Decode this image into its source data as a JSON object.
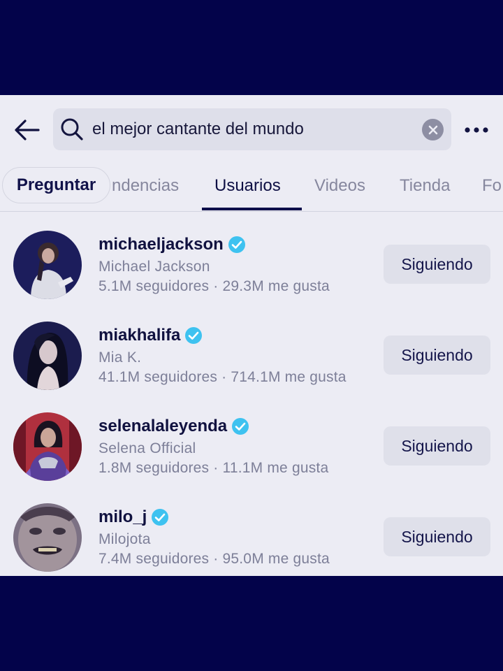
{
  "search": {
    "query": "el mejor cantante del mundo"
  },
  "tabs": {
    "pill_label": "Preguntar",
    "items": [
      {
        "label": "ndencias"
      },
      {
        "label": "Usuarios"
      },
      {
        "label": "Videos"
      },
      {
        "label": "Tienda"
      },
      {
        "label": "Fo"
      }
    ],
    "active": "Usuarios"
  },
  "users": [
    {
      "username": "michaeljackson",
      "display_name": "Michael Jackson",
      "stats": "5.1M seguidores · 29.3M me gusta",
      "button": "Siguiendo",
      "verified": true
    },
    {
      "username": "miakhalifa",
      "display_name": "Mia K.",
      "stats": "41.1M seguidores · 714.1M me gusta",
      "button": "Siguiendo",
      "verified": true
    },
    {
      "username": "selenalaleyenda",
      "display_name": "Selena Official",
      "stats": "1.8M seguidores · 11.1M me gusta",
      "button": "Siguiendo",
      "verified": true
    },
    {
      "username": "milo_j",
      "display_name": "Milojota",
      "stats": "7.4M seguidores · 95.0M me gusta",
      "button": "Siguiendo",
      "verified": true
    }
  ],
  "colors": {
    "frame": "#03034a",
    "background": "#ececf4",
    "accent": "#0d0e4a",
    "verified": "#3ec2f0",
    "muted_text": "#7d7f98"
  },
  "icons": [
    "back-arrow-icon",
    "search-icon",
    "clear-icon",
    "more-icon",
    "verified-icon"
  ]
}
